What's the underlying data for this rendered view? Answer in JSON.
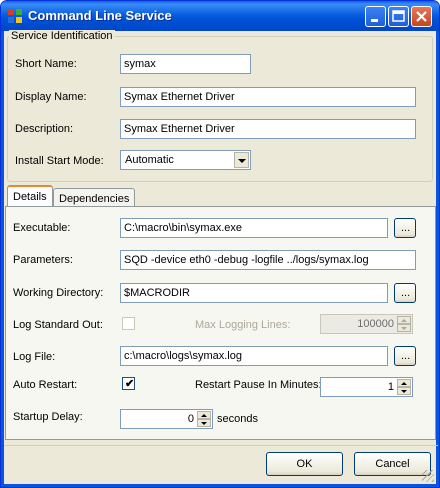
{
  "window": {
    "title": "Command Line Service",
    "accent": "#0a54e0",
    "background": "#ece9d8"
  },
  "identification": {
    "group_label": "Service Identification",
    "short_name_label": "Short Name:",
    "short_name_value": "symax",
    "display_name_label": "Display Name:",
    "display_name_value": "Symax Ethernet Driver",
    "description_label": "Description:",
    "description_value": "Symax Ethernet Driver",
    "start_mode_label": "Install Start Mode:",
    "start_mode_value": "Automatic"
  },
  "tabs": [
    {
      "label": "Details",
      "active": true
    },
    {
      "label": "Dependencies",
      "active": false
    }
  ],
  "details": {
    "executable_label": "Executable:",
    "executable_value": "C:\\macro\\bin\\symax.exe",
    "parameters_label": "Parameters:",
    "parameters_value": "SQD -device eth0 -debug -logfile ../logs/symax.log",
    "working_dir_label": "Working Directory:",
    "working_dir_value": "$MACRODIR",
    "log_stdout_label": "Log Standard Out:",
    "log_stdout_checked": false,
    "max_logging_label": "Max Logging Lines:",
    "max_logging_value": "100000",
    "log_file_label": "Log File:",
    "log_file_value": "c:\\macro\\logs\\symax.log",
    "auto_restart_label": "Auto Restart:",
    "auto_restart_checked": true,
    "restart_pause_label": "Restart Pause In Minutes:",
    "restart_pause_value": "1",
    "startup_delay_label": "Startup Delay:",
    "startup_delay_value": "0",
    "startup_delay_unit": "seconds",
    "browse_label": "..."
  },
  "buttons": {
    "ok": "OK",
    "cancel": "Cancel"
  }
}
